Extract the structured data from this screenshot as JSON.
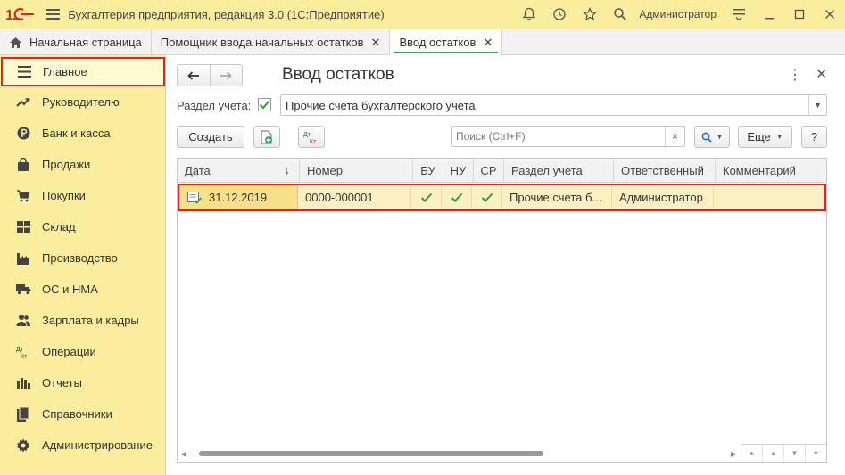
{
  "app": {
    "title": "Бухгалтерия предприятия, редакция 3.0  (1С:Предприятие)",
    "user": "Администратор"
  },
  "tabs": [
    {
      "label": "Начальная страница"
    },
    {
      "label": "Помощник ввода начальных остатков"
    },
    {
      "label": "Ввод остатков"
    }
  ],
  "sidebar": {
    "items": [
      {
        "label": "Главное",
        "icon": "menu-lines-icon"
      },
      {
        "label": "Руководителю",
        "icon": "trend-icon"
      },
      {
        "label": "Банк и касса",
        "icon": "ruble-icon"
      },
      {
        "label": "Продажи",
        "icon": "bag-icon"
      },
      {
        "label": "Покупки",
        "icon": "cart-icon"
      },
      {
        "label": "Склад",
        "icon": "grid-icon"
      },
      {
        "label": "Производство",
        "icon": "factory-icon"
      },
      {
        "label": "ОС и НМА",
        "icon": "truck-icon"
      },
      {
        "label": "Зарплата и кадры",
        "icon": "people-icon"
      },
      {
        "label": "Операции",
        "icon": "dt-kt-icon",
        "icon_text": "Дт\nКт"
      },
      {
        "label": "Отчеты",
        "icon": "bar-chart-icon"
      },
      {
        "label": "Справочники",
        "icon": "books-icon"
      },
      {
        "label": "Администрирование",
        "icon": "gear-icon"
      }
    ]
  },
  "form": {
    "title": "Ввод остатков",
    "section_label": "Раздел учета:",
    "section_value": "Прочие счета бухгалтерского учета",
    "create_label": "Создать",
    "dtkt_label": "Дт Кт",
    "search_placeholder": "Поиск (Ctrl+F)",
    "clear_label": "×",
    "more_label": "Еще",
    "help_label": "?"
  },
  "table": {
    "columns": [
      "Дата",
      "Номер",
      "БУ",
      "НУ",
      "СР",
      "Раздел учета",
      "Ответственный",
      "Комментарий"
    ],
    "sort_indicator": "↓",
    "rows": [
      {
        "date": "31.12.2019",
        "number": "0000-000001",
        "bu": "✔",
        "nu": "✔",
        "sr": "✔",
        "section": "Прочие счета б...",
        "responsible": "Администратор",
        "comment": ""
      }
    ]
  },
  "colors": {
    "title_bar": "#fbed9e",
    "sidebar": "#fbed9e",
    "highlight_red": "#d9262a",
    "check_green": "#2e9e3c",
    "tab_underline": "#3aa55a"
  }
}
